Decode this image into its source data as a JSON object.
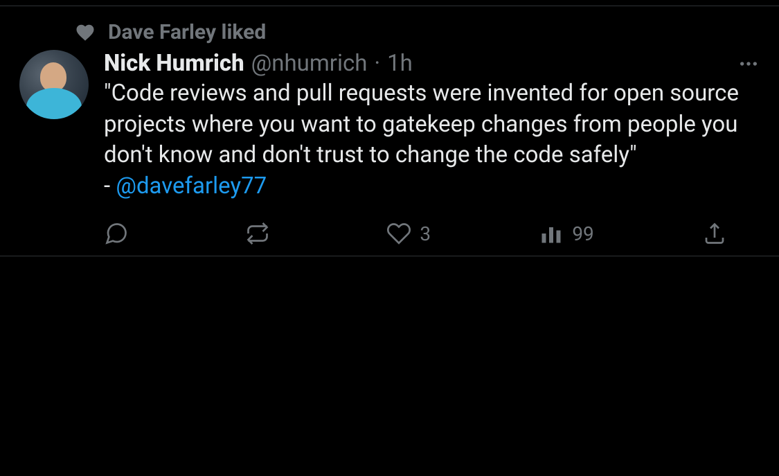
{
  "social_context": {
    "text": "Dave Farley liked"
  },
  "author": {
    "name": "Nick Humrich",
    "handle": "@nhumrich",
    "timestamp": "1h"
  },
  "tweet": {
    "body": "\"Code reviews and pull requests were invented for open source projects where you want to gatekeep changes from people you don't know and don't trust to change the code safely\"",
    "attribution_prefix": "- ",
    "mention": "@davefarley77"
  },
  "actions": {
    "replies": "",
    "retweets": "",
    "likes": "3",
    "views": "99"
  }
}
